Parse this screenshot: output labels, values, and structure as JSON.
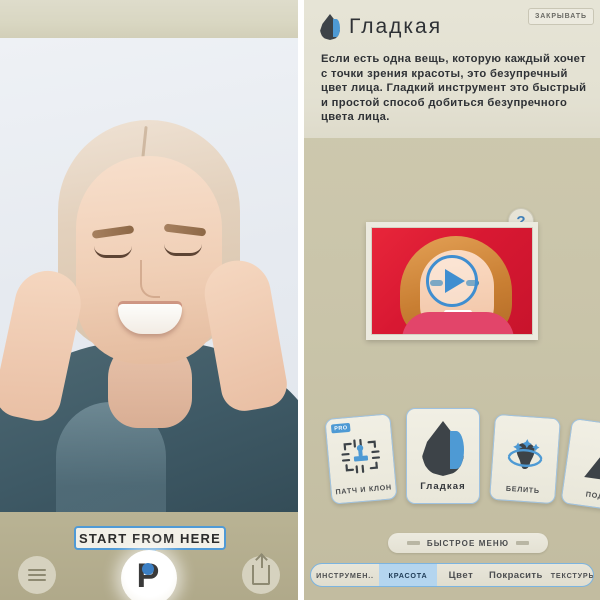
{
  "left_panel": {
    "name": "photo-editor-home",
    "photo_alt": "smiling blonde woman holding face with both hands",
    "start_button_label": "START FROM HERE",
    "menu_icon": "hamburger-menu-icon",
    "logo_icon": "app-logo-p-icon",
    "logo_letter": "P",
    "share_icon": "share-upload-icon"
  },
  "right_panel": {
    "info_sheet": {
      "drop_icon": "water-drop-icon",
      "title": "Гладкая",
      "close_label": "ЗАКРЫВАТЬ",
      "body": "Если есть одна вещь, которую каждый хочет с точки зрения красоты, это безупречный цвет лица. Гладкий инструмент  это быстрый и простой способ добиться безупречного цвета лица."
    },
    "video": {
      "play_icon": "play-triangle-icon",
      "help_icon": "question-mark-icon",
      "help_label": "?",
      "thumbnail_alt": "girl with red background tutorial video"
    },
    "tool_cards": [
      {
        "id": "patch-and-clone",
        "label": "ПАТЧ И КЛОН",
        "badge": "PRO",
        "icon": "patch-clone-icon",
        "selected": false
      },
      {
        "id": "smooth",
        "label": "Гладкая",
        "badge": "",
        "icon": "water-drop-icon",
        "selected": true
      },
      {
        "id": "whiten",
        "label": "БЕЛИТЬ",
        "badge": "",
        "icon": "tooth-sparkle-icon",
        "selected": false
      },
      {
        "id": "lift",
        "label": "ПОД",
        "badge": "",
        "icon": "triangle-icon",
        "selected": false
      }
    ],
    "quick_menu_label": "БЫСТРОЕ МЕНЮ",
    "tabs": [
      {
        "id": "tools",
        "label": "ИНСТРУМЕН..",
        "active": false
      },
      {
        "id": "beauty",
        "label": "КРАСОТА",
        "active": true
      },
      {
        "id": "color",
        "label": "Цвет",
        "active": false
      },
      {
        "id": "paint",
        "label": "Покрасить",
        "active": false
      },
      {
        "id": "textures",
        "label": "ТЕКСТУРЫ",
        "active": false
      }
    ]
  },
  "colors": {
    "accent_blue": "#4e9ad4",
    "tab_active_bg": "#b4d5ef",
    "panel_bg": "#c9c4a9",
    "sheet_bg": "#e3e1d2",
    "drop_dark": "#3d4348"
  }
}
